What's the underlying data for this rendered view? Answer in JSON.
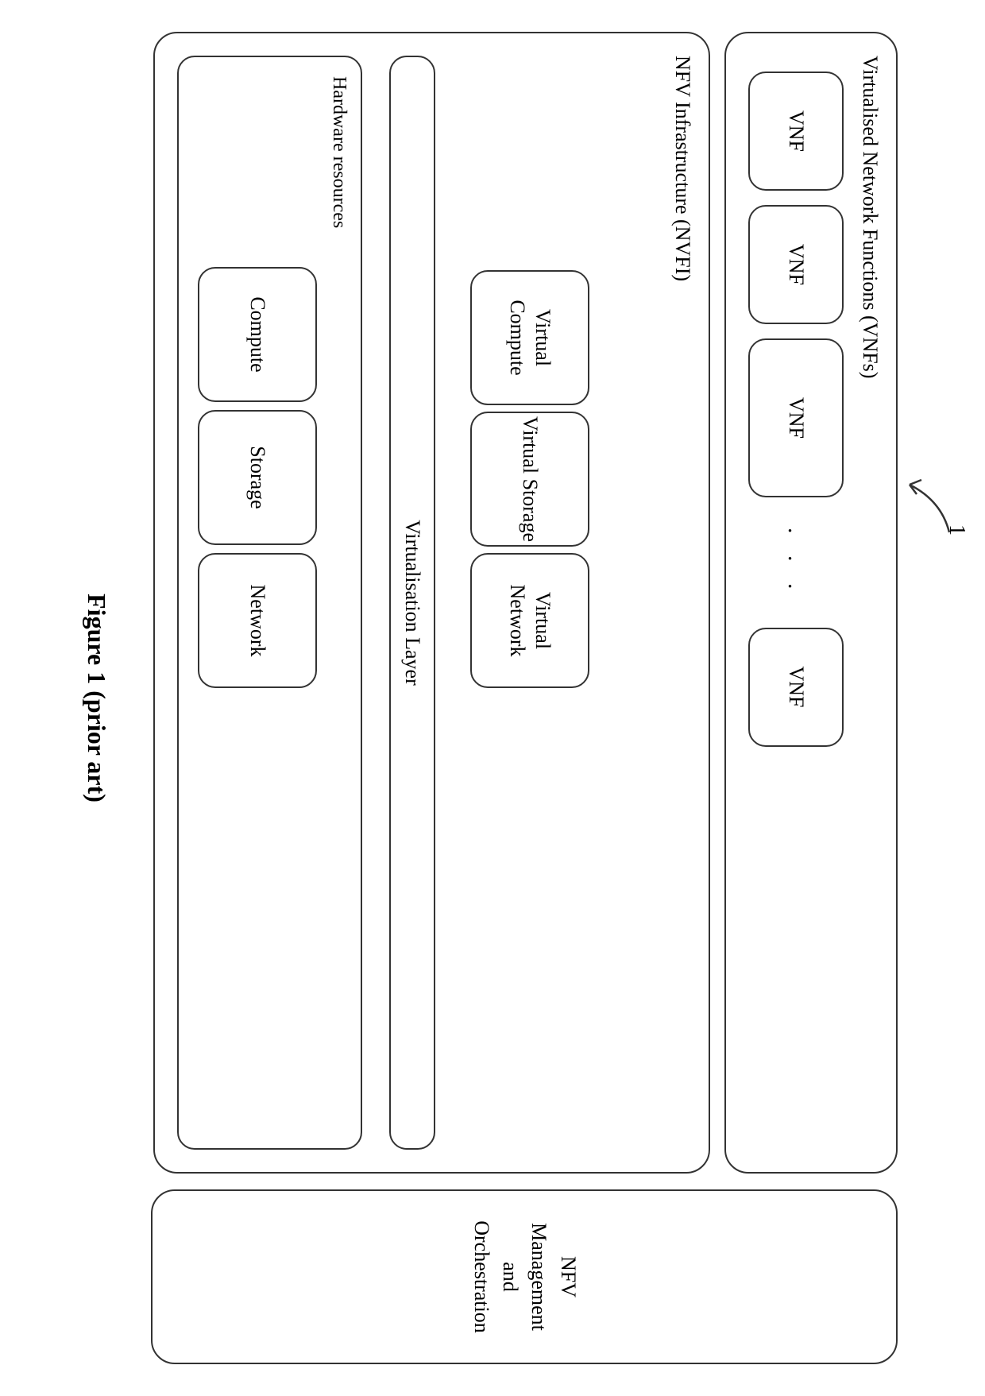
{
  "reference_number": "1",
  "vnfs": {
    "title": "Virtualised Network Functions (VNFs)",
    "items": [
      "VNF",
      "VNF",
      "VNF",
      "VNF"
    ],
    "ellipsis": ". . ."
  },
  "nvfi": {
    "title": "NFV Infrastructure (NVFI)",
    "virtual": {
      "compute": "Virtual Compute",
      "storage": "Virtual Storage",
      "network": "Virtual Network"
    },
    "virtualisation_layer": "Virtualisation Layer",
    "hardware": {
      "title": "Hardware resources",
      "compute": "Compute",
      "storage": "Storage",
      "network": "Network"
    }
  },
  "mano": "NFV Management and Orchestration",
  "caption": "Figure 1 (prior art)"
}
